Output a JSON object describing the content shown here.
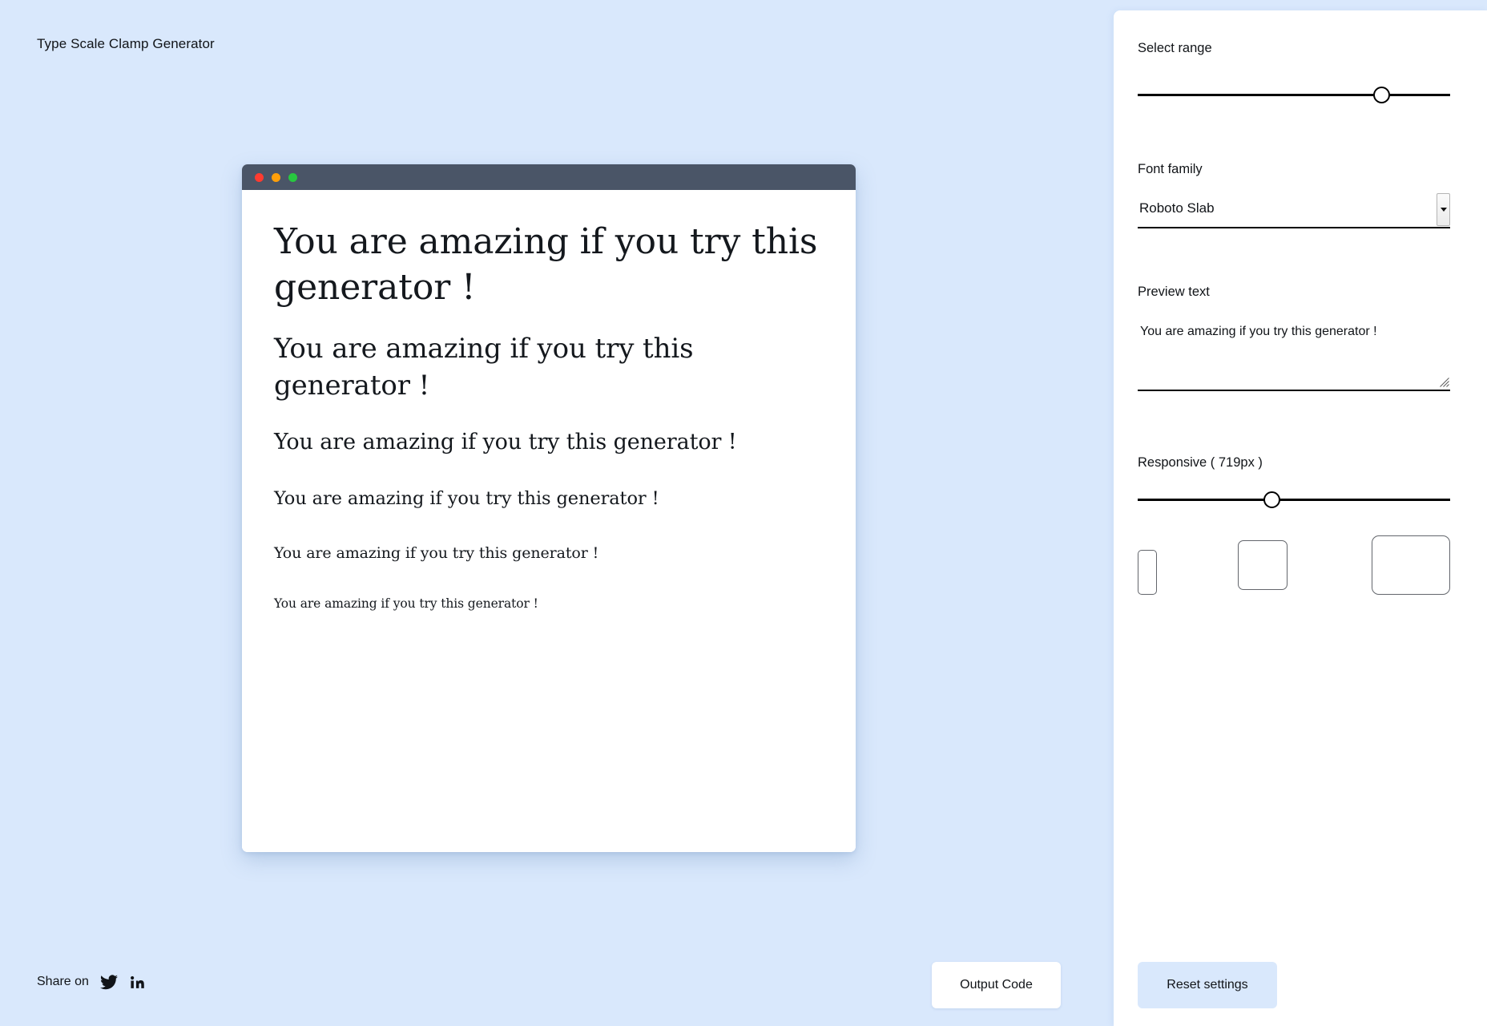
{
  "app": {
    "title": "Type Scale Clamp Generator",
    "background_color": "#d9e8fc",
    "panel_color": "#ffffff",
    "accent_color": "#d9e8fc"
  },
  "mockup": {
    "titlebar_color": "#4a5567",
    "traffic_lights": [
      {
        "name": "close",
        "color": "#ff3b30"
      },
      {
        "name": "minimize",
        "color": "#ff9f0a"
      },
      {
        "name": "maximize",
        "color": "#28c840"
      }
    ],
    "preview_lines": [
      "You are amazing if you try this generator !",
      "You are amazing if you try this generator !",
      "You are amazing if you try this generator !",
      "You are amazing if you try this generator !",
      "You are amazing if you try this generator !",
      "You are amazing if you try this generator !"
    ]
  },
  "share": {
    "label": "Share on",
    "links": [
      {
        "icon": "twitter-icon",
        "name": "twitter"
      },
      {
        "icon": "linkedin-icon",
        "name": "linkedin"
      }
    ]
  },
  "actions": {
    "output_code_label": "Output Code",
    "reset_settings_label": "Reset settings"
  },
  "settings": {
    "select_range": {
      "label": "Select range",
      "value_percent": 78
    },
    "font_family": {
      "label": "Font family",
      "value": "Roboto Slab"
    },
    "preview_text": {
      "label": "Preview text",
      "value": "You are amazing if you try this generator !",
      "placeholder": "You are amazing if you try this generator !"
    },
    "responsive": {
      "label": "Responsive ( 719px )",
      "width_px": "719px",
      "value_percent": 43
    },
    "devices": [
      {
        "name": "mobile",
        "icon": "mobile-device-icon"
      },
      {
        "name": "tablet",
        "icon": "tablet-device-icon"
      },
      {
        "name": "desktop",
        "icon": "desktop-device-icon"
      }
    ]
  }
}
